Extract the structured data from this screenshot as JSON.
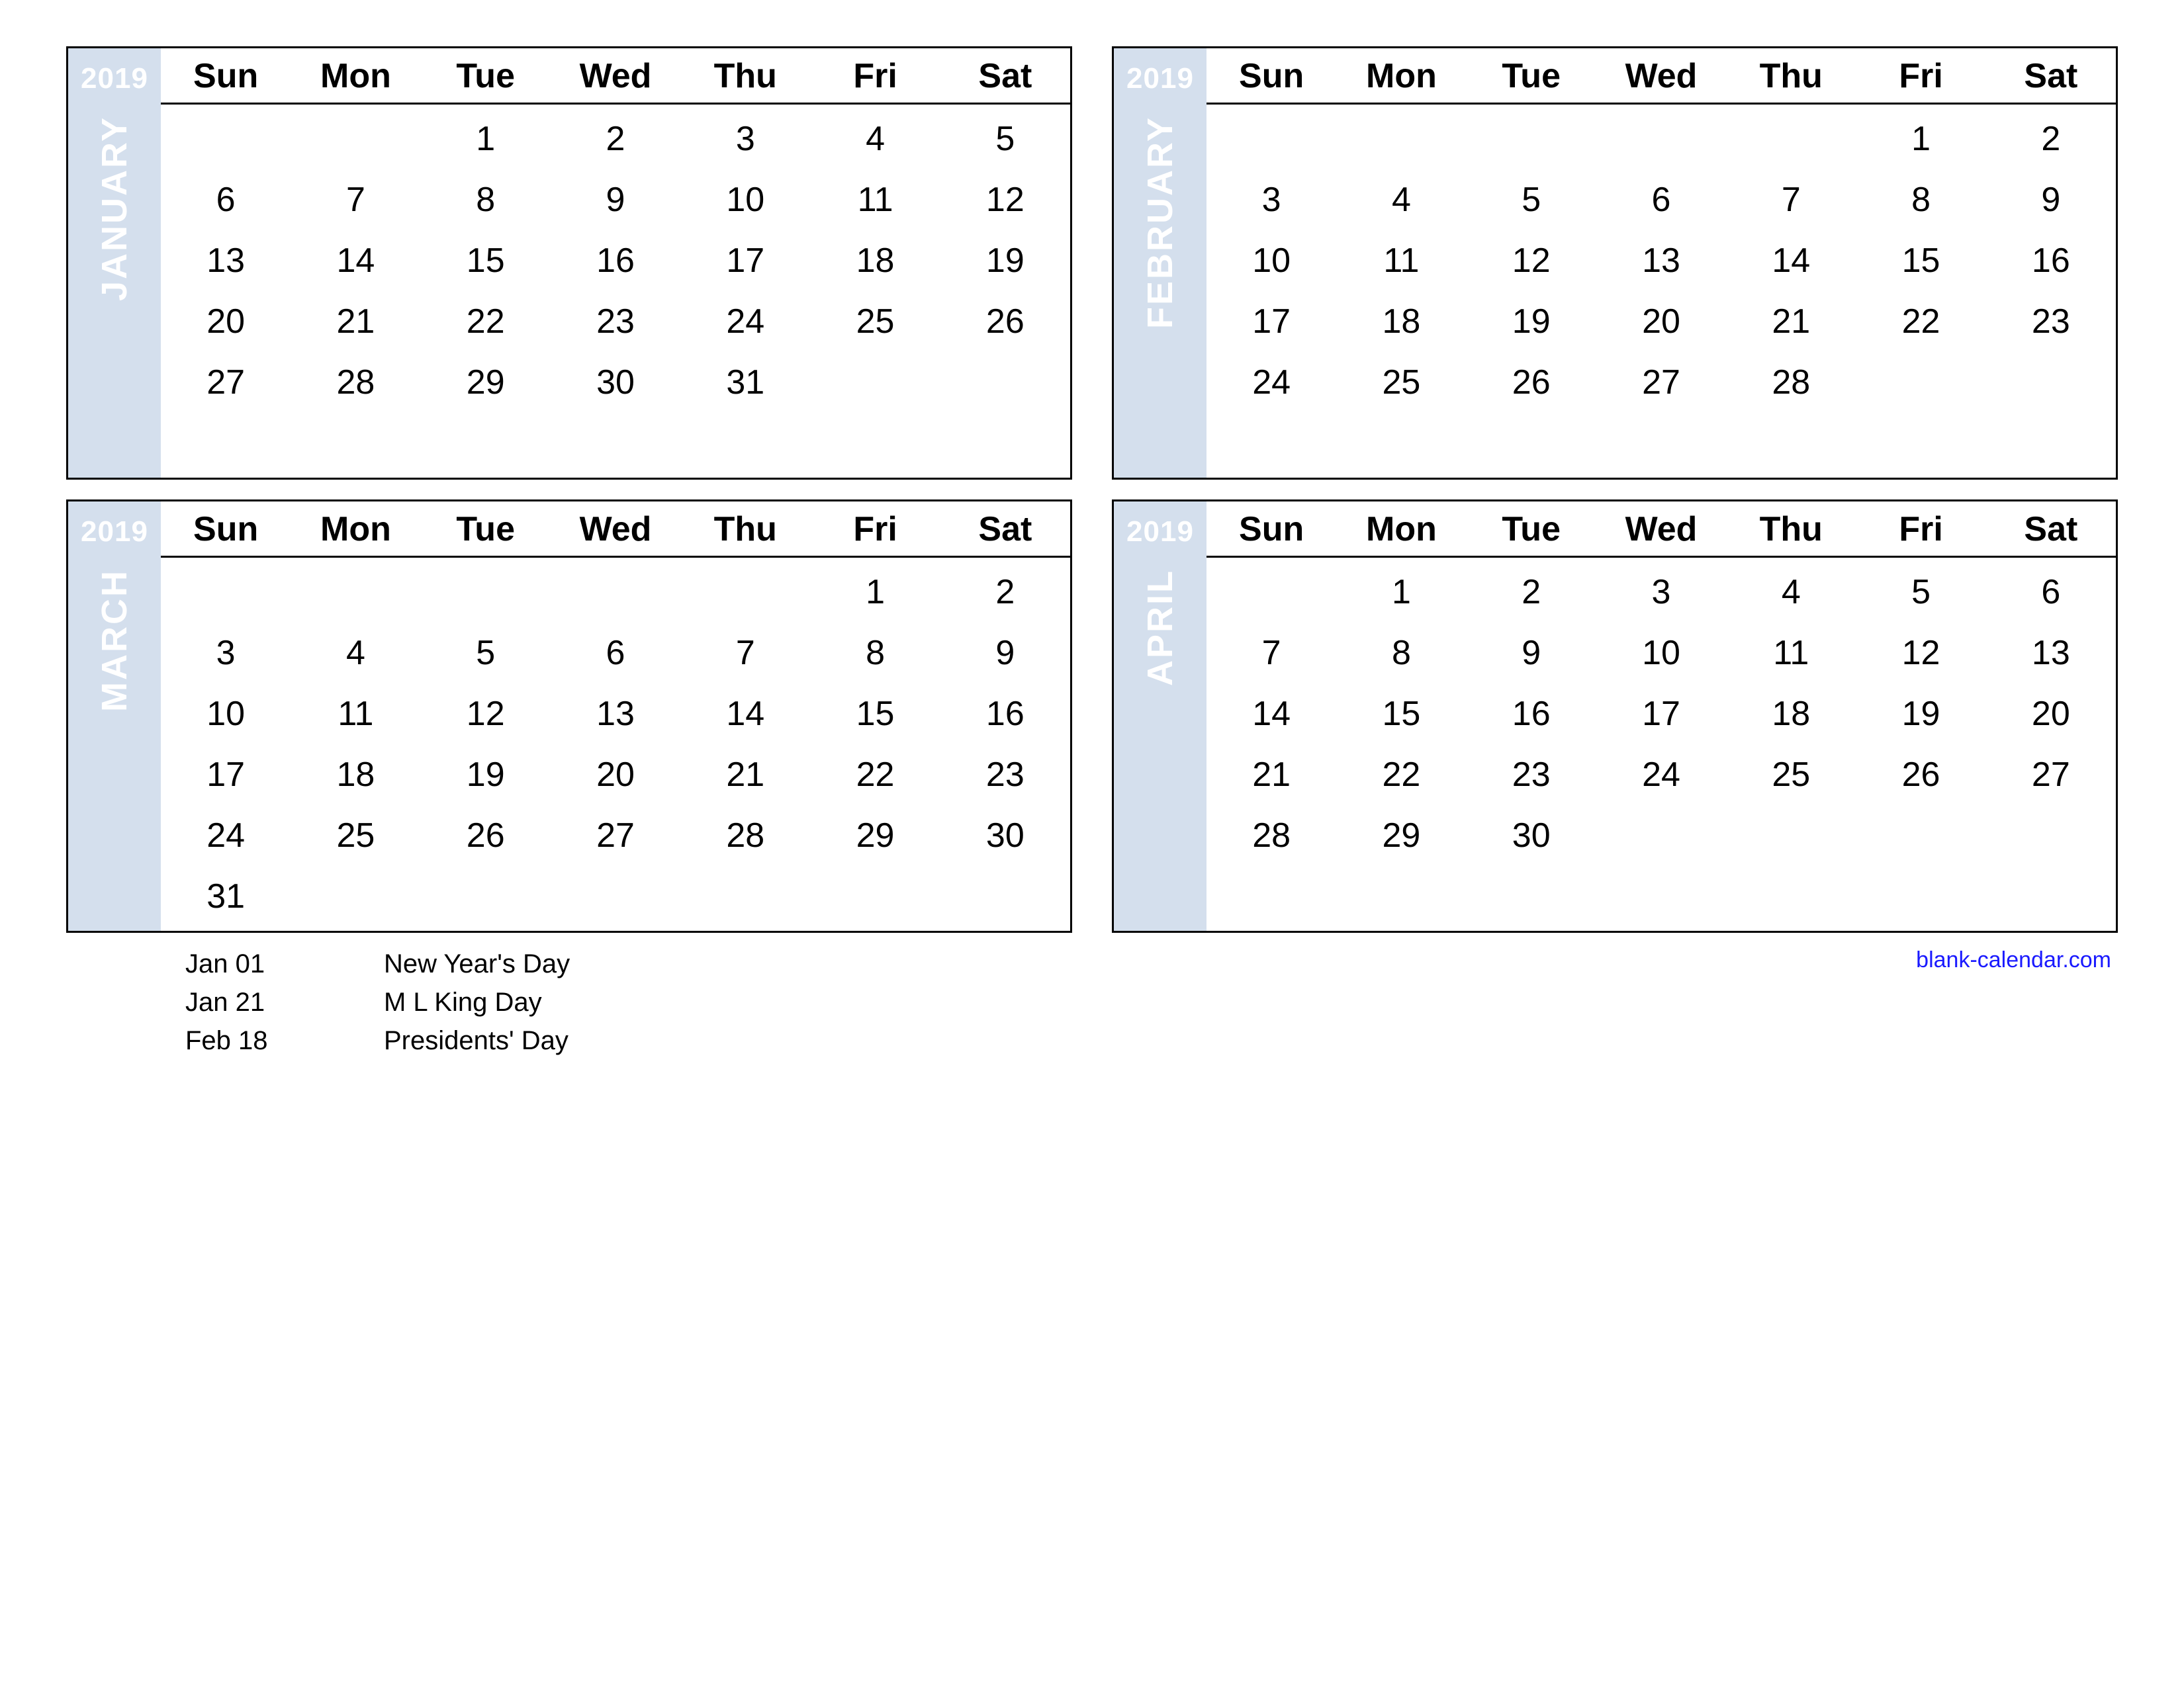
{
  "year": "2019",
  "dow": [
    "Sun",
    "Mon",
    "Tue",
    "Wed",
    "Thu",
    "Fri",
    "Sat"
  ],
  "months": [
    {
      "name": "JANUARY",
      "start": 2,
      "days": 31,
      "rows": 6
    },
    {
      "name": "FEBRUARY",
      "start": 5,
      "days": 28,
      "rows": 6
    },
    {
      "name": "MARCH",
      "start": 5,
      "days": 31,
      "rows": 6
    },
    {
      "name": "APRIL",
      "start": 1,
      "days": 30,
      "rows": 6
    }
  ],
  "holidays": [
    {
      "date": "Jan 01",
      "name": "New Year's Day"
    },
    {
      "date": "Jan 21",
      "name": "M L King Day"
    },
    {
      "date": "Feb 18",
      "name": "Presidents' Day"
    }
  ],
  "credit": "blank-calendar.com"
}
